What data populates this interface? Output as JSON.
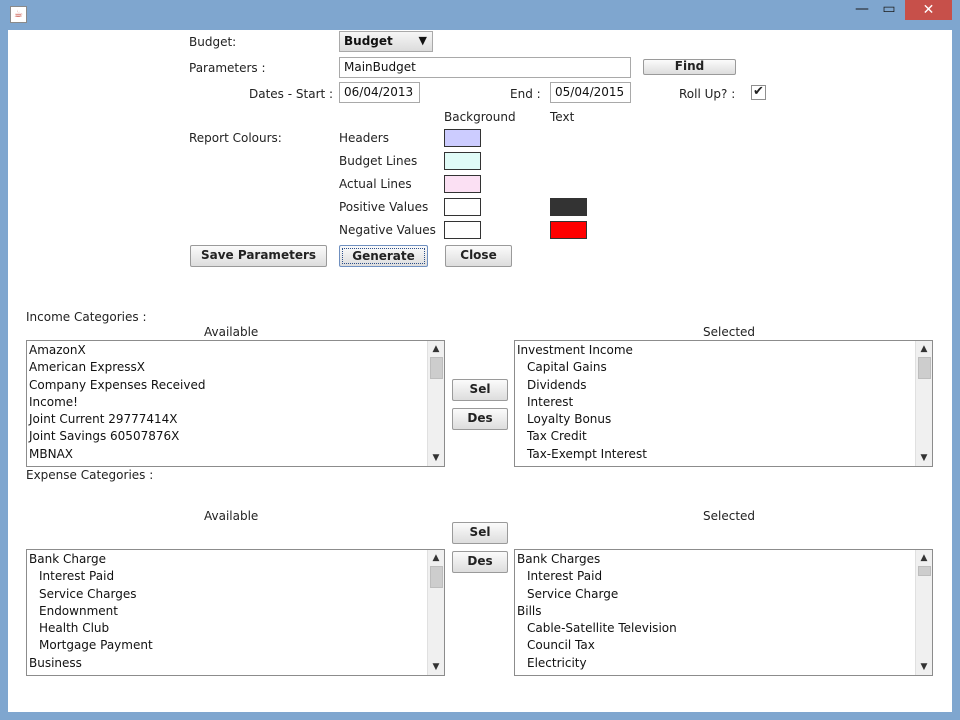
{
  "window": {
    "close_glyph": "✕",
    "min_glyph": "—",
    "max_glyph": "▭",
    "icon_glyph": "☕"
  },
  "form": {
    "budget_label": "Budget:",
    "budget_value": "Budget",
    "parameters_label": "Parameters :",
    "parameters_value": "MainBudget",
    "find_label": "Find",
    "dates_label": "Dates - Start :",
    "start_value": "06/04/2013",
    "end_label": "End :",
    "end_value": "05/04/2015",
    "rollup_label": "Roll Up? :",
    "rollup_checked": "✔"
  },
  "colours": {
    "section_label": "Report Colours:",
    "background_header": "Background",
    "text_header": "Text",
    "rows": [
      {
        "label": "Headers",
        "bg": "#ccccff",
        "text": null
      },
      {
        "label": "Budget Lines",
        "bg": "#e0fbf7",
        "text": null
      },
      {
        "label": "Actual Lines",
        "bg": "#fbe0f3",
        "text": null
      },
      {
        "label": "Positive Values",
        "bg": "#ffffff",
        "text": "#333333"
      },
      {
        "label": "Negative Values",
        "bg": "#ffffff",
        "text": "#ff0000"
      }
    ]
  },
  "buttons": {
    "save": "Save Parameters",
    "generate": "Generate",
    "close": "Close",
    "sel": "Sel",
    "des": "Des"
  },
  "income": {
    "label": "Income Categories :",
    "available_header": "Available",
    "selected_header": "Selected",
    "available": [
      {
        "text": "AmazonX",
        "child": false
      },
      {
        "text": "American ExpressX",
        "child": false
      },
      {
        "text": "Company Expenses Received",
        "child": false
      },
      {
        "text": "Income!",
        "child": false
      },
      {
        "text": "Joint Current 29777414X",
        "child": false
      },
      {
        "text": "Joint Savings 60507876X",
        "child": false
      },
      {
        "text": "MBNAX",
        "child": false
      }
    ],
    "selected": [
      {
        "text": "Investment Income",
        "child": false
      },
      {
        "text": "Capital Gains",
        "child": true
      },
      {
        "text": "Dividends",
        "child": true
      },
      {
        "text": "Interest",
        "child": true
      },
      {
        "text": "Loyalty Bonus",
        "child": true
      },
      {
        "text": "Tax Credit",
        "child": true
      },
      {
        "text": "Tax-Exempt Interest",
        "child": true
      }
    ]
  },
  "expense": {
    "label": "Expense Categories :",
    "available_header": "Available",
    "selected_header": "Selected",
    "available": [
      {
        "text": "Bank Charge",
        "child": false
      },
      {
        "text": "Interest Paid",
        "child": true
      },
      {
        "text": "Service Charges",
        "child": true
      },
      {
        "text": "Endownment",
        "child": true
      },
      {
        "text": "Health Club",
        "child": true
      },
      {
        "text": "Mortgage Payment",
        "child": true
      },
      {
        "text": "Business",
        "child": false
      }
    ],
    "selected": [
      {
        "text": "Bank Charges",
        "child": false
      },
      {
        "text": "Interest Paid",
        "child": true
      },
      {
        "text": "Service Charge",
        "child": true
      },
      {
        "text": "Bills",
        "child": false
      },
      {
        "text": "Cable-Satellite Television",
        "child": true
      },
      {
        "text": "Council Tax",
        "child": true
      },
      {
        "text": "Electricity",
        "child": true
      }
    ]
  },
  "scroll": {
    "up_glyph": "▲",
    "down_glyph": "▼"
  }
}
